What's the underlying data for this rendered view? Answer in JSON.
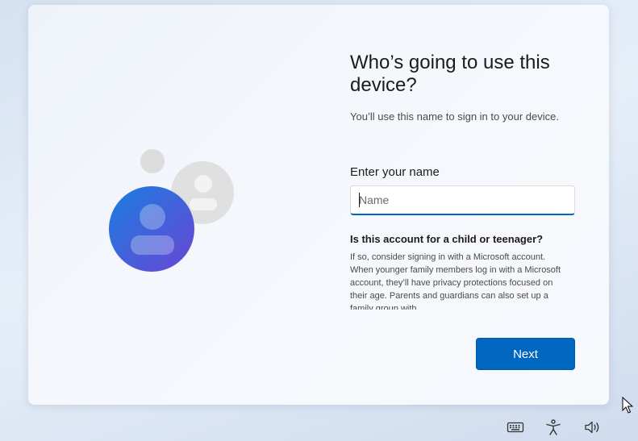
{
  "main": {
    "title": "Who’s going to use this device?",
    "subtitle": "You’ll use this name to sign in to your device.",
    "name_label": "Enter your name",
    "name_value": "",
    "name_placeholder": "Name",
    "child_heading": "Is this account for a child or teenager?",
    "child_body": "If so, consider signing in with a Microsoft account. When younger family members log in with a Microsoft account, they’ll have privacy protections focused on their age. Parents and guardians can also set up a family group with",
    "next_label": "Next"
  },
  "tray": {
    "icons": [
      "keyboard-icon",
      "accessibility-icon",
      "volume-icon"
    ]
  },
  "colors": {
    "accent": "#0067c0",
    "avatar_front_start": "#1a73d9",
    "avatar_front_end": "#6b4fd6",
    "avatar_back": "#d9d9d9"
  }
}
